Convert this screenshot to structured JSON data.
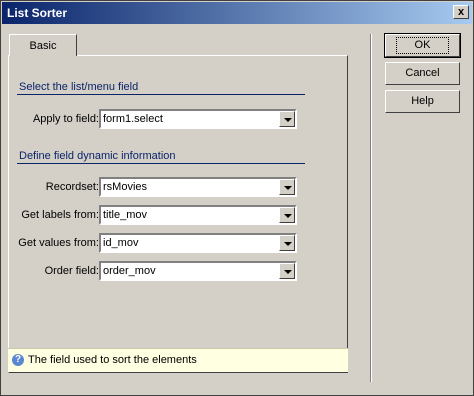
{
  "window": {
    "title": "List Sorter",
    "close_symbol": "x"
  },
  "tabs": [
    {
      "label": "Basic"
    }
  ],
  "sections": {
    "select_list": "Select the list/menu field",
    "dynamic_info": "Define field dynamic information"
  },
  "fields": {
    "apply_to": {
      "label": "Apply to field:",
      "value": "form1.select"
    },
    "recordset": {
      "label": "Recordset:",
      "value": "rsMovies"
    },
    "labels_from": {
      "label": "Get labels from:",
      "value": "title_mov"
    },
    "values_from": {
      "label": "Get values from:",
      "value": "id_mov"
    },
    "order_field": {
      "label": "Order field:",
      "value": "order_mov"
    }
  },
  "hint": {
    "icon": "help-icon",
    "icon_glyph": "?",
    "text": "The field used to sort the elements"
  },
  "buttons": {
    "ok": "OK",
    "cancel": "Cancel",
    "help": "Help"
  }
}
